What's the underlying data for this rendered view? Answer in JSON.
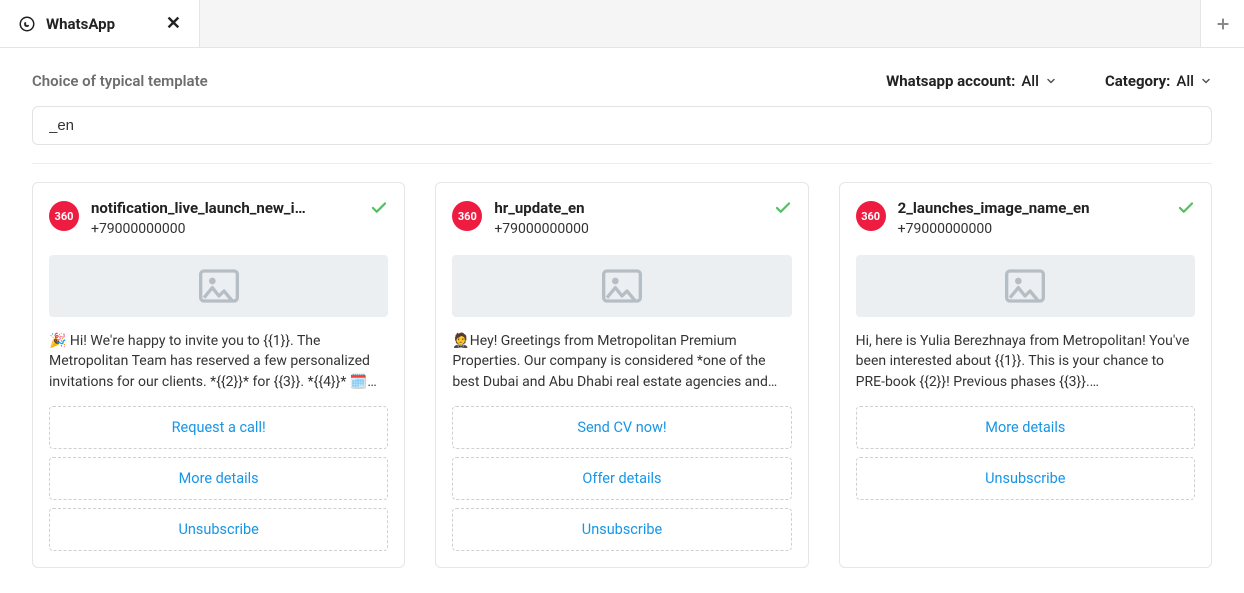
{
  "tab": {
    "title": "WhatsApp"
  },
  "subtitle": "Choice of typical template",
  "filters": {
    "account_label": "Whatsapp account:",
    "account_value": "All",
    "category_label": "Category:",
    "category_value": "All"
  },
  "search": {
    "value": "_en",
    "placeholder": ""
  },
  "avatar_text": "360",
  "cards": [
    {
      "name": "notification_live_launch_new_i…",
      "phone": "+79000000000",
      "body": "🎉 Hi! We're happy to invite you to {{1}}. The Metropolitan Team has reserved a few personalized invitations for our clients. *{{2}}* for {{3}}. *{{4}}* 🗓️…",
      "buttons": [
        "Request a call!",
        "More details",
        "Unsubscribe"
      ]
    },
    {
      "name": "hr_update_en",
      "phone": "+79000000000",
      "body": "🤵Hey! Greetings from Metropolitan Premium Properties. Our company is considered *one of the best Dubai and Abu Dhabi real estate agencies and…",
      "buttons": [
        "Send CV now!",
        "Offer details",
        "Unsubscribe"
      ]
    },
    {
      "name": "2_launches_image_name_en",
      "phone": "+79000000000",
      "body": "Hi, here is Yulia Berezhnaya from Metropolitan! You've been interested about {{1}}. This is your chance to PRE-book {{2}}! Previous phases {{3}}.…",
      "buttons": [
        "More details",
        "Unsubscribe"
      ]
    }
  ]
}
